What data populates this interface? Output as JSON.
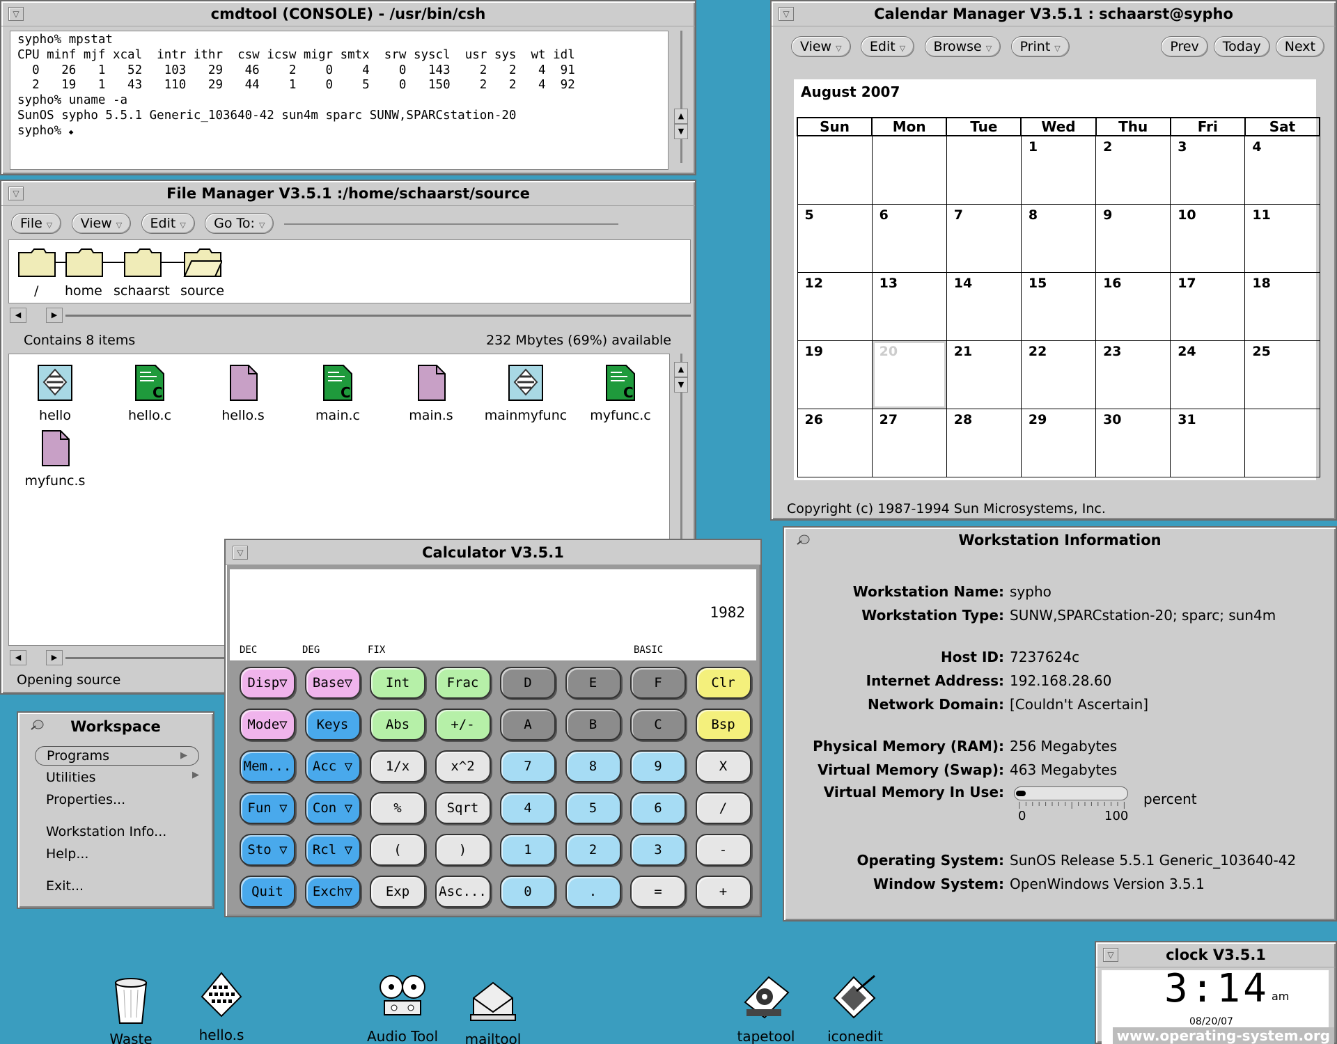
{
  "cmdtool": {
    "title": "cmdtool (CONSOLE) - /usr/bin/csh",
    "lines": [
      "sypho% mpstat",
      "CPU minf mjf xcal  intr ithr  csw icsw migr smtx  srw syscl  usr sys  wt idl",
      "  0   26   1   52   103   29   46    2    0    4    0   143    2   2   4  91",
      "  2   19   1   43   110   29   44    1    0    5    0   150    2   2   4  92",
      "sypho% uname -a",
      "SunOS sypho 5.5.1 Generic_103640-42 sun4m sparc SUNW,SPARCstation-20",
      "sypho% "
    ]
  },
  "filemanager": {
    "title": "File Manager V3.5.1  :/home/schaarst/source",
    "menus": [
      "File",
      "View",
      "Edit",
      "Go To:"
    ],
    "path": [
      "/",
      "home",
      "schaarst",
      "source"
    ],
    "status_left": "Contains 8 items",
    "status_right": "232 Mbytes (69%) available",
    "files": [
      {
        "name": "hello",
        "type": "exec"
      },
      {
        "name": "hello.c",
        "type": "c"
      },
      {
        "name": "hello.s",
        "type": "doc"
      },
      {
        "name": "main.c",
        "type": "c"
      },
      {
        "name": "main.s",
        "type": "doc"
      },
      {
        "name": "mainmyfunc",
        "type": "exec"
      },
      {
        "name": "myfunc.c",
        "type": "c"
      },
      {
        "name": "myfunc.s",
        "type": "doc"
      }
    ],
    "footer": "Opening source"
  },
  "calendar": {
    "title": "Calendar Manager V3.5.1  : schaarst@sypho",
    "menus": [
      "View",
      "Edit",
      "Browse",
      "Print"
    ],
    "nav": [
      "Prev",
      "Today",
      "Next"
    ],
    "month": "August 2007",
    "days": [
      "Sun",
      "Mon",
      "Tue",
      "Wed",
      "Thu",
      "Fri",
      "Sat"
    ],
    "weeks": [
      [
        "",
        "",
        "",
        "1",
        "2",
        "3",
        "4"
      ],
      [
        "5",
        "6",
        "7",
        "8",
        "9",
        "10",
        "11"
      ],
      [
        "12",
        "13",
        "14",
        "15",
        "16",
        "17",
        "18"
      ],
      [
        "19",
        "20",
        "21",
        "22",
        "23",
        "24",
        "25"
      ],
      [
        "26",
        "27",
        "28",
        "29",
        "30",
        "31",
        ""
      ]
    ],
    "today": "20",
    "copyright": "Copyright (c) 1987-1994 Sun Microsystems, Inc."
  },
  "wsinfo": {
    "title": "Workstation Information",
    "rows": [
      {
        "k": "Workstation Name:",
        "v": "sypho"
      },
      {
        "k": "Workstation Type:",
        "v": "SUNW,SPARCstation-20; sparc; sun4m"
      },
      {
        "k": "Host ID:",
        "v": "7237624c"
      },
      {
        "k": "Internet Address:",
        "v": "192.168.28.60"
      },
      {
        "k": "Network Domain:",
        "v": "[Couldn't Ascertain]"
      },
      {
        "k": "Physical Memory (RAM):",
        "v": "256 Megabytes"
      },
      {
        "k": "Virtual Memory (Swap):",
        "v": "463 Megabytes"
      },
      {
        "k": "Virtual Memory In Use:",
        "v": "percent"
      },
      {
        "k": "Operating System:",
        "v": "SunOS Release 5.5.1 Generic_103640-42"
      },
      {
        "k": "Window System:",
        "v": "OpenWindows Version 3.5.1"
      }
    ],
    "gauge_min": "0",
    "gauge_max": "100",
    "gauge_value_percent": 4
  },
  "calculator": {
    "title": "Calculator V3.5.1",
    "display": "1982",
    "modes": [
      "DEC",
      "DEG",
      "FIX",
      "BASIC"
    ],
    "keys": [
      [
        "Disp▽",
        "Base▽",
        "Int",
        "Frac",
        "D",
        "E",
        "F",
        "Clr"
      ],
      [
        "Mode▽",
        "Keys",
        "Abs",
        "+/-",
        "A",
        "B",
        "C",
        "Bsp"
      ],
      [
        "Mem...",
        "Acc ▽",
        "1/x",
        "x^2",
        "7",
        "8",
        "9",
        "X"
      ],
      [
        "Fun ▽",
        "Con ▽",
        "%",
        "Sqrt",
        "4",
        "5",
        "6",
        "/"
      ],
      [
        "Sto ▽",
        "Rcl ▽",
        "(",
        ")",
        "1",
        "2",
        "3",
        "-"
      ],
      [
        "Quit",
        "Exch▽",
        "Exp",
        "Asc...",
        "0",
        ".",
        "=",
        "+"
      ]
    ],
    "colors": {
      "pink": "#f0b4ec",
      "blue": "#49a9ec",
      "green": "#b6f0a8",
      "gray": "#8c8c8c",
      "lightblue": "#a6dcf4",
      "white": "#e6e6e6",
      "yellow": "#f4f07c"
    }
  },
  "workspace": {
    "title": "Workspace",
    "items": [
      "Programs",
      "Utilities",
      "Properties...",
      "Workstation Info...",
      "Help...",
      "Exit..."
    ]
  },
  "clock": {
    "title": "clock V3.5.1",
    "time": "3:14",
    "ampm": "am",
    "date": "08/20/07"
  },
  "desktop_icons": [
    {
      "label": "Waste",
      "icon": "trash-icon"
    },
    {
      "label": "hello.s",
      "icon": "keyboard-icon"
    },
    {
      "label": "Audio Tool",
      "icon": "tape-reels-icon"
    },
    {
      "label": "mailtool",
      "icon": "mail-tray-icon"
    },
    {
      "label": "tapetool",
      "icon": "tape-drive-icon"
    },
    {
      "label": "iconedit",
      "icon": "iconedit-icon"
    }
  ],
  "watermark": "www.operating-system.org"
}
